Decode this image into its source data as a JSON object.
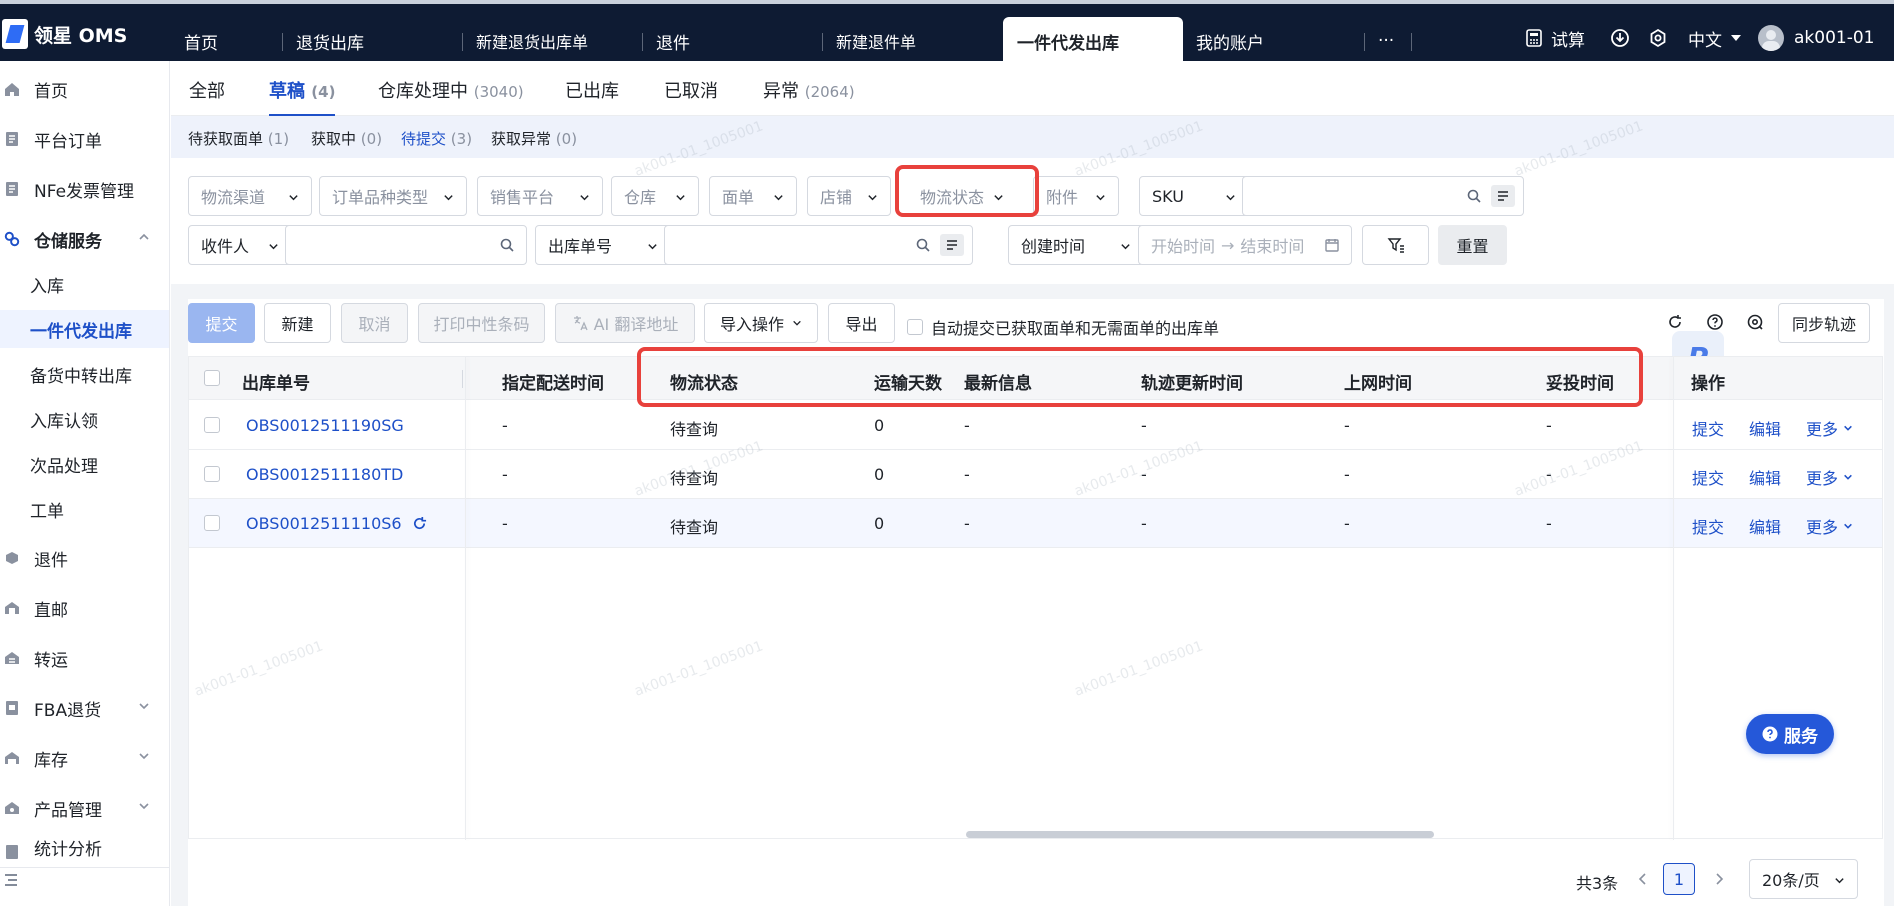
{
  "app": {
    "title": "领星 OMS"
  },
  "top_tabs": [
    {
      "label": "首页"
    },
    {
      "label": "退货出库"
    },
    {
      "label": "新建退货出库单"
    },
    {
      "label": "退件"
    },
    {
      "label": "新建退件单"
    },
    {
      "label": "一件代发出库"
    },
    {
      "label": "我的账户"
    },
    {
      "label": "···"
    }
  ],
  "top_right": {
    "calc_label": "试算",
    "lang_label": "中文",
    "user": "ak001-01"
  },
  "sidebar": {
    "items": [
      {
        "label": "首页",
        "icon": "home-icon"
      },
      {
        "label": "平台订单",
        "icon": "order-icon"
      },
      {
        "label": "NFe发票管理",
        "icon": "invoice-icon"
      },
      {
        "label": "仓储服务",
        "icon": "warehouse-icon"
      },
      {
        "label": "退件",
        "icon": "return-icon"
      },
      {
        "label": "直邮",
        "icon": "mail-icon"
      },
      {
        "label": "转运",
        "icon": "transfer-icon"
      },
      {
        "label": "FBA退货",
        "icon": "fba-icon"
      },
      {
        "label": "库存",
        "icon": "inventory-icon"
      },
      {
        "label": "产品管理",
        "icon": "product-icon"
      },
      {
        "label": "统计分析",
        "icon": "stats-icon"
      }
    ],
    "sub_items": [
      {
        "label": "入库"
      },
      {
        "label": "一件代发出库"
      },
      {
        "label": "备货中转出库"
      },
      {
        "label": "入库认领"
      },
      {
        "label": "次品处理"
      },
      {
        "label": "工单"
      }
    ]
  },
  "status_tabs": [
    {
      "label": "全部",
      "count": ""
    },
    {
      "label": "草稿",
      "count": "(4)"
    },
    {
      "label": "仓库处理中",
      "count": "(3040)"
    },
    {
      "label": "已出库",
      "count": ""
    },
    {
      "label": "已取消",
      "count": ""
    },
    {
      "label": "异常",
      "count": "(2064)"
    }
  ],
  "sub_tabs": [
    {
      "label": "待获取面单",
      "count": "(1)"
    },
    {
      "label": "获取中",
      "count": "(0)"
    },
    {
      "label": "待提交",
      "count": "(3)"
    },
    {
      "label": "获取异常",
      "count": "(0)"
    }
  ],
  "filters": {
    "row1": [
      {
        "label": "物流渠道"
      },
      {
        "label": "订单品种类型"
      },
      {
        "label": "销售平台"
      },
      {
        "label": "仓库"
      },
      {
        "label": "面单"
      },
      {
        "label": "店铺"
      },
      {
        "label": "物流状态"
      },
      {
        "label": "附件"
      }
    ],
    "sku_label": "SKU",
    "receiver_label": "收件人",
    "order_no_label": "出库单号",
    "created_label": "创建时间",
    "start_placeholder": "开始时间",
    "arrow": "→",
    "end_placeholder": "结束时间",
    "reset_label": "重置"
  },
  "actions": {
    "submit": "提交",
    "create": "新建",
    "cancel": "取消",
    "print": "打印中性条码",
    "ai": "AI 翻译地址",
    "import": "导入操作",
    "export": "导出",
    "auto_submit": "自动提交已获取面单和无需面单的出库单",
    "sync": "同步轨迹"
  },
  "table": {
    "headers": [
      "出库单号",
      "指定配送时间",
      "物流状态",
      "运输天数",
      "最新信息",
      "轨迹更新时间",
      "上网时间",
      "妥投时间",
      "操作"
    ],
    "rows": [
      {
        "order": "OBS0012511190SG",
        "delivery": "-",
        "status": "待查询",
        "days": "0",
        "latest": "-",
        "track": "-",
        "online": "-",
        "delivered": "-"
      },
      {
        "order": "OBS0012511180TD",
        "delivery": "-",
        "status": "待查询",
        "days": "0",
        "latest": "-",
        "track": "-",
        "online": "-",
        "delivered": "-"
      },
      {
        "order": "OBS0012511110S6",
        "delivery": "-",
        "status": "待查询",
        "days": "0",
        "latest": "-",
        "track": "-",
        "online": "-",
        "delivered": "-"
      }
    ],
    "row_actions": {
      "submit": "提交",
      "edit": "编辑",
      "more": "更多"
    }
  },
  "pagination": {
    "total": "共3条",
    "page": "1",
    "page_size": "20条/页"
  },
  "service_button": "服务",
  "watermark": "ak001-01_1005001",
  "colors": {
    "nav_bg": "#0e1b33",
    "accent": "#1e50c8",
    "highlight_border": "#e8413c"
  }
}
